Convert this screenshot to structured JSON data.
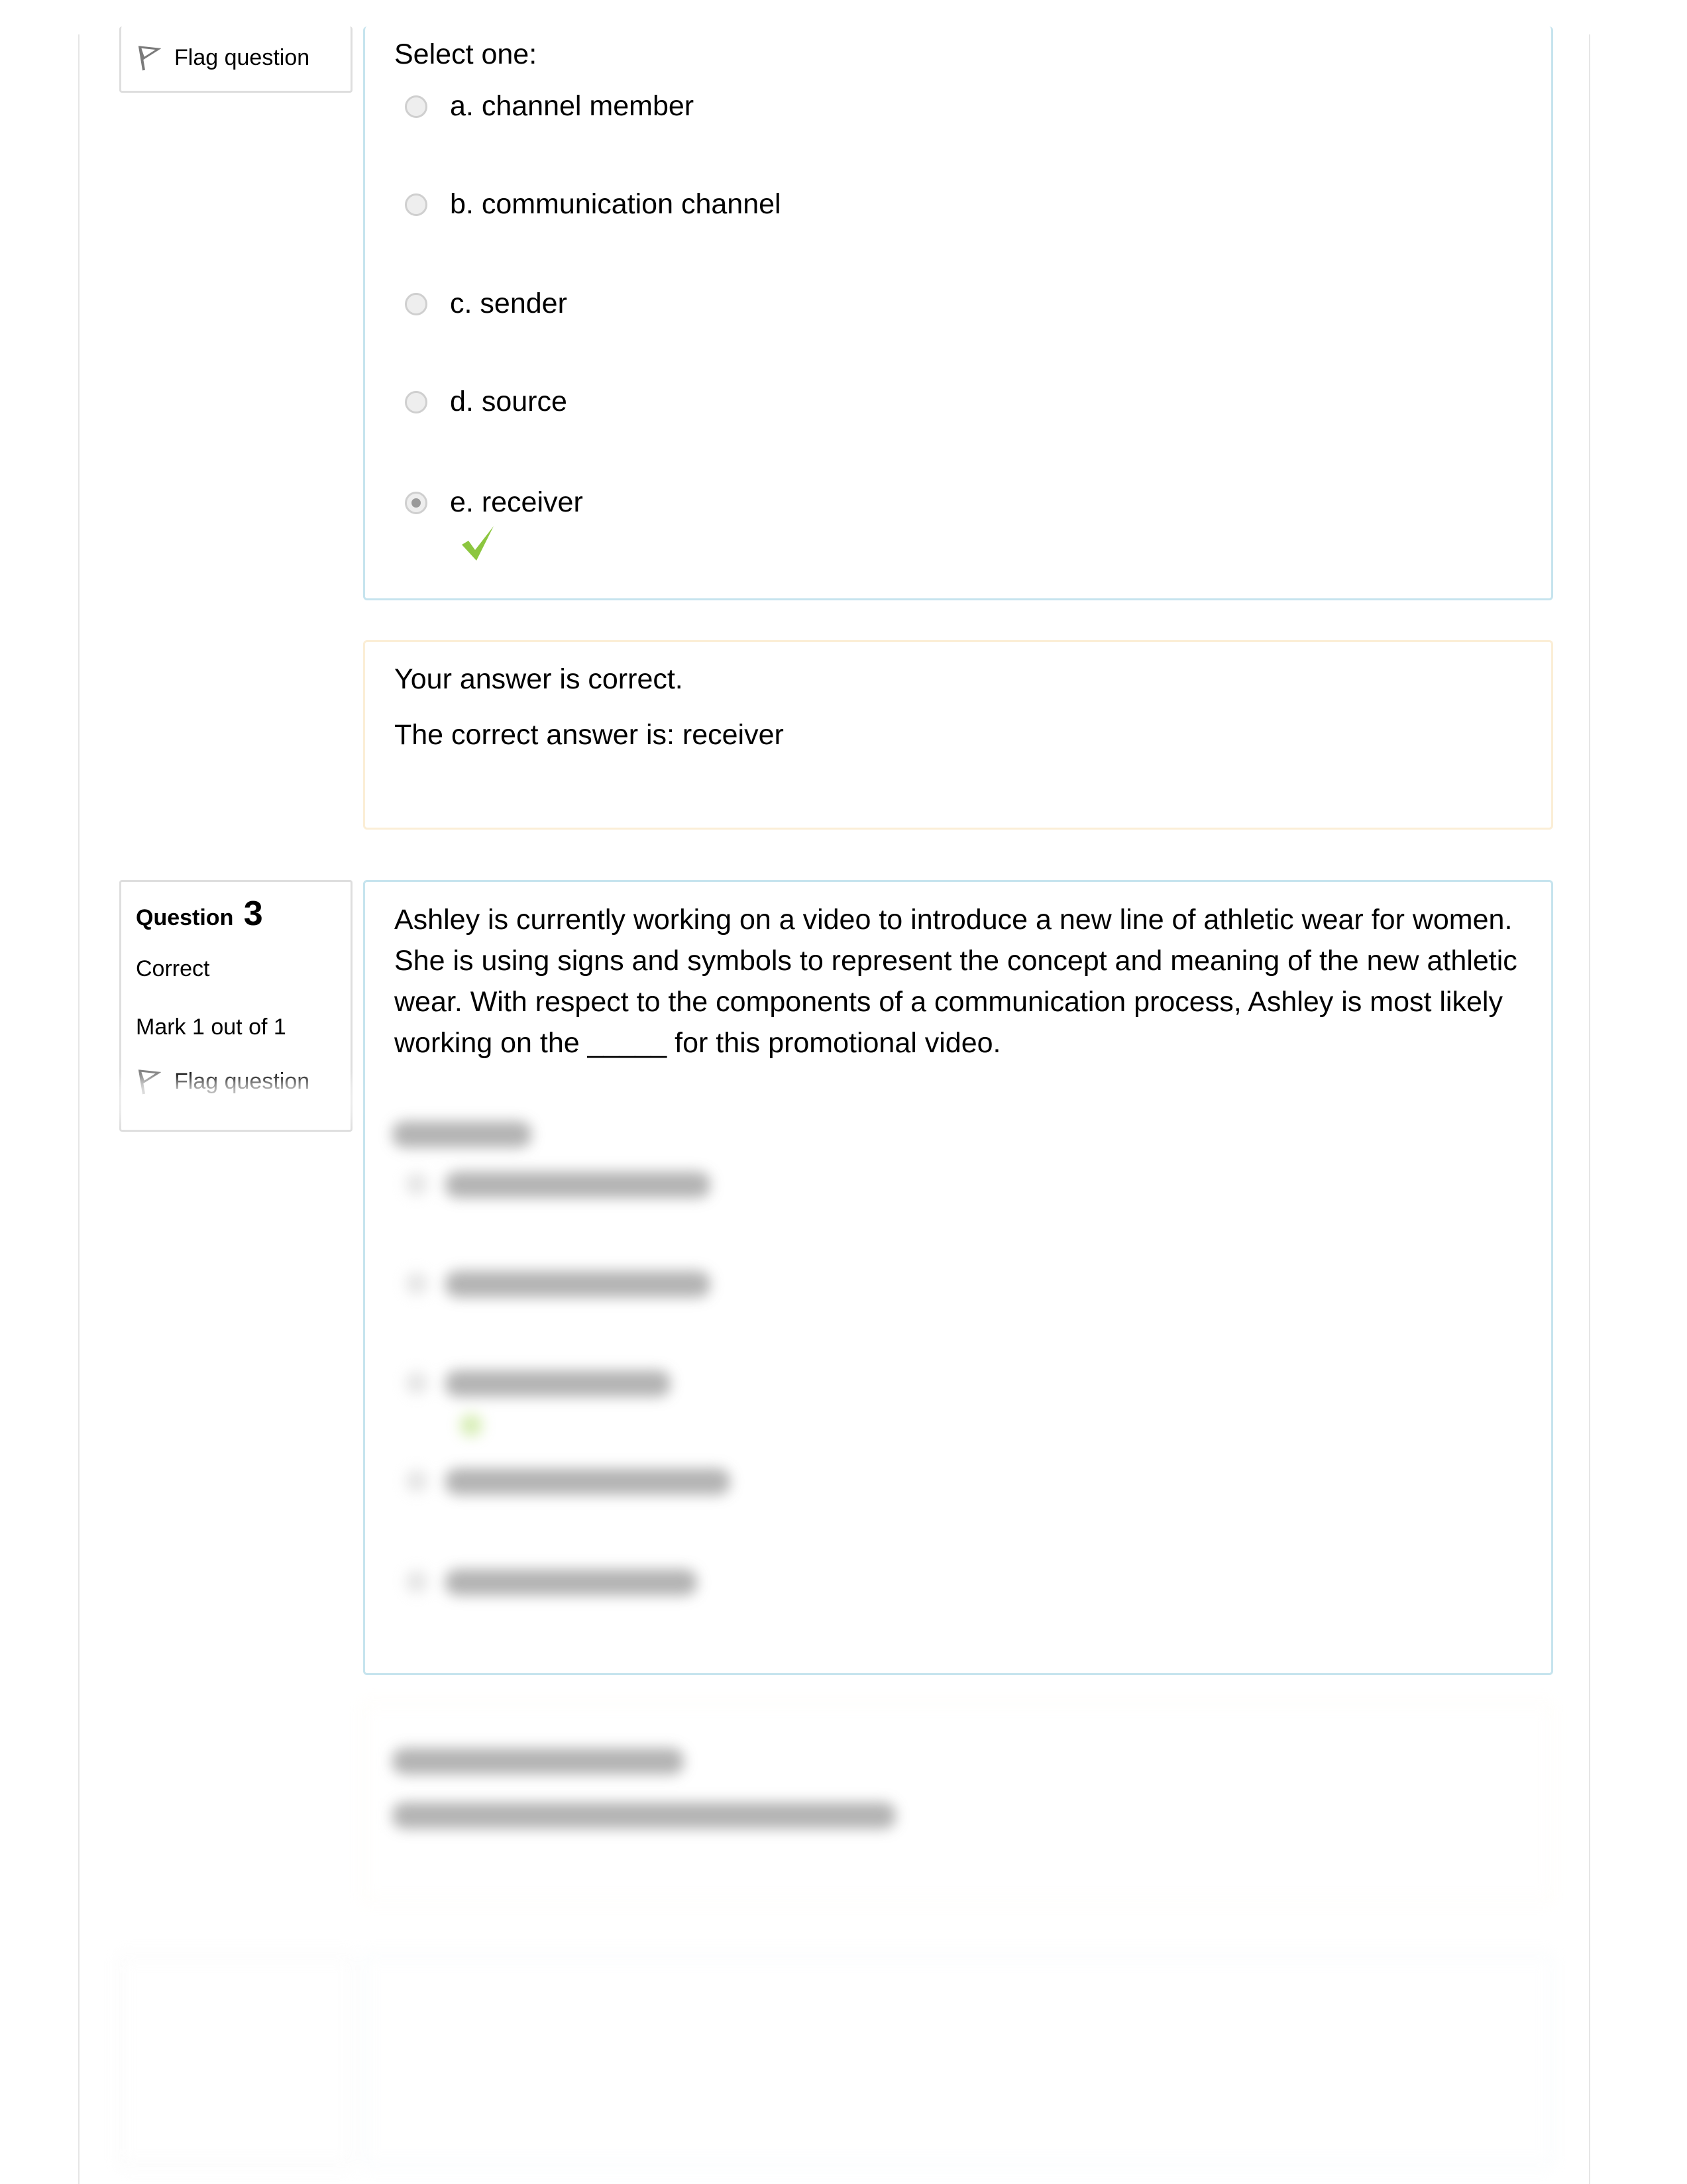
{
  "question2": {
    "flag_label": "Flag question",
    "prompt": "Select one:",
    "options": [
      {
        "letter": "a.",
        "text": "channel member",
        "selected": false
      },
      {
        "letter": "b.",
        "text": "communication channel",
        "selected": false
      },
      {
        "letter": "c.",
        "text": "sender",
        "selected": false
      },
      {
        "letter": "d.",
        "text": "source",
        "selected": false
      },
      {
        "letter": "e.",
        "text": "receiver",
        "selected": true,
        "marked_correct": true
      }
    ],
    "feedback": {
      "result": "Your answer is correct.",
      "correct_answer": "The correct answer is: receiver"
    }
  },
  "question3": {
    "label": "Question",
    "number": "3",
    "state": "Correct",
    "mark": "Mark 1 out of 1",
    "flag_label": "Flag question",
    "text": "Ashley is currently working on a video to introduce a new line of athletic wear for women. She is using signs and symbols to represent the concept and meaning of the new athletic wear. With respect to the components of a communication process, Ashley is most likely working on the _____ for this promotional video."
  },
  "colors": {
    "content_border": "#c6e4ee",
    "feedback_border": "#fbeed6",
    "info_border": "#dedede",
    "correct_check": "#8cc63f"
  }
}
